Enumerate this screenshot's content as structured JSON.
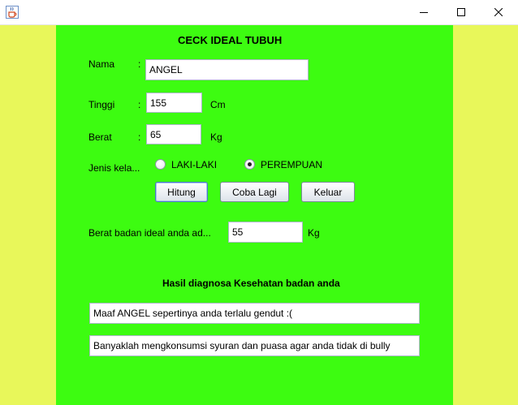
{
  "window": {
    "icon": "java-cup-icon",
    "controls": [
      "minimize-icon",
      "maximize-icon",
      "close-icon"
    ]
  },
  "form": {
    "title": "CECK IDEAL TUBUH",
    "nama": {
      "label": "Nama",
      "colon": ":",
      "value": "ANGEL"
    },
    "tinggi": {
      "label": "Tinggi",
      "colon": ":",
      "value": "155",
      "unit": "Cm"
    },
    "berat": {
      "label": "Berat",
      "colon": ":",
      "value": "65",
      "unit": "Kg"
    },
    "gender": {
      "label": "Jenis kela...",
      "options": [
        {
          "label": "LAKI-LAKI",
          "checked": false
        },
        {
          "label": "PEREMPUAN",
          "checked": true
        }
      ]
    },
    "buttons": {
      "hitung": "Hitung",
      "coba_lagi": "Coba Lagi",
      "keluar": "Keluar"
    },
    "ideal": {
      "label": "Berat badan ideal anda ad...",
      "value": "55",
      "unit": "Kg"
    },
    "diagnosa": {
      "title": "Hasil diagnosa Kesehatan badan anda",
      "result1": "Maaf ANGEL sepertinya anda terlalu gendut :(",
      "result2": "Banyaklah mengkonsumsi syuran dan puasa agar anda tidak di bully"
    }
  },
  "colors": {
    "panel": "#3dfc11",
    "frame": "#e8f75a"
  }
}
